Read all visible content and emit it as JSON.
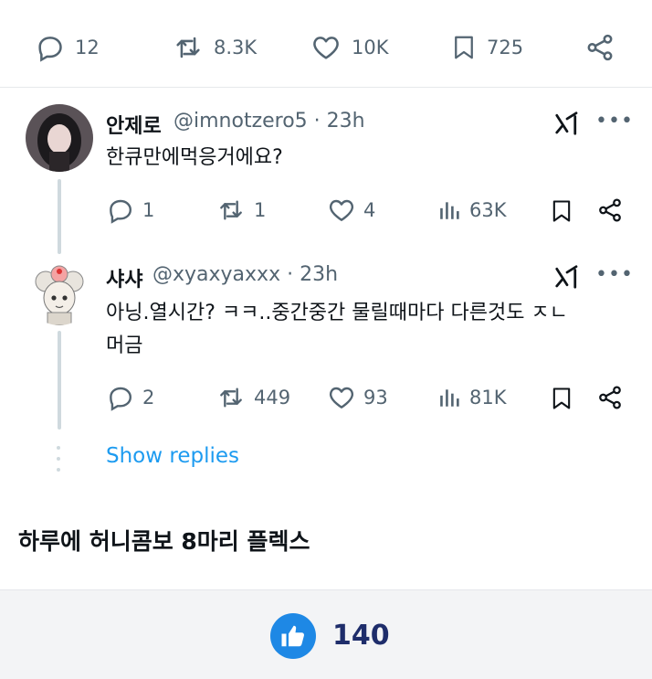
{
  "tweet_actions": {
    "replies": "12",
    "reposts": "8.3K",
    "likes": "10K",
    "bookmarks": "725"
  },
  "replies": [
    {
      "name": "안제로",
      "handle": "@imnotzero5 · 23h",
      "text": "한큐만에먹응거에요?",
      "stats": {
        "replies": "1",
        "reposts": "1",
        "likes": "4",
        "views": "63K"
      }
    },
    {
      "name": "샤샤",
      "handle": "@xyaxyaxxx · 23h",
      "text_line1": "아닝.열시간? ㅋㅋ..중간중간 물릴때마다 다른것도 ㅈㄴ",
      "text_line2": "머금",
      "stats": {
        "replies": "2",
        "reposts": "449",
        "likes": "93",
        "views": "81K"
      }
    }
  ],
  "show_replies": "Show replies",
  "caption": "하루에 허니콤보 8마리 플렉스",
  "like_count": "140",
  "colors": {
    "link": "#1d9bf0",
    "muted": "#536471",
    "like_button": "#1e88e5"
  },
  "icons": [
    "reply-icon",
    "repost-icon",
    "heart-icon",
    "bookmark-icon",
    "share-icon",
    "views-icon",
    "grok-icon",
    "more-icon",
    "thumbs-up-icon"
  ]
}
